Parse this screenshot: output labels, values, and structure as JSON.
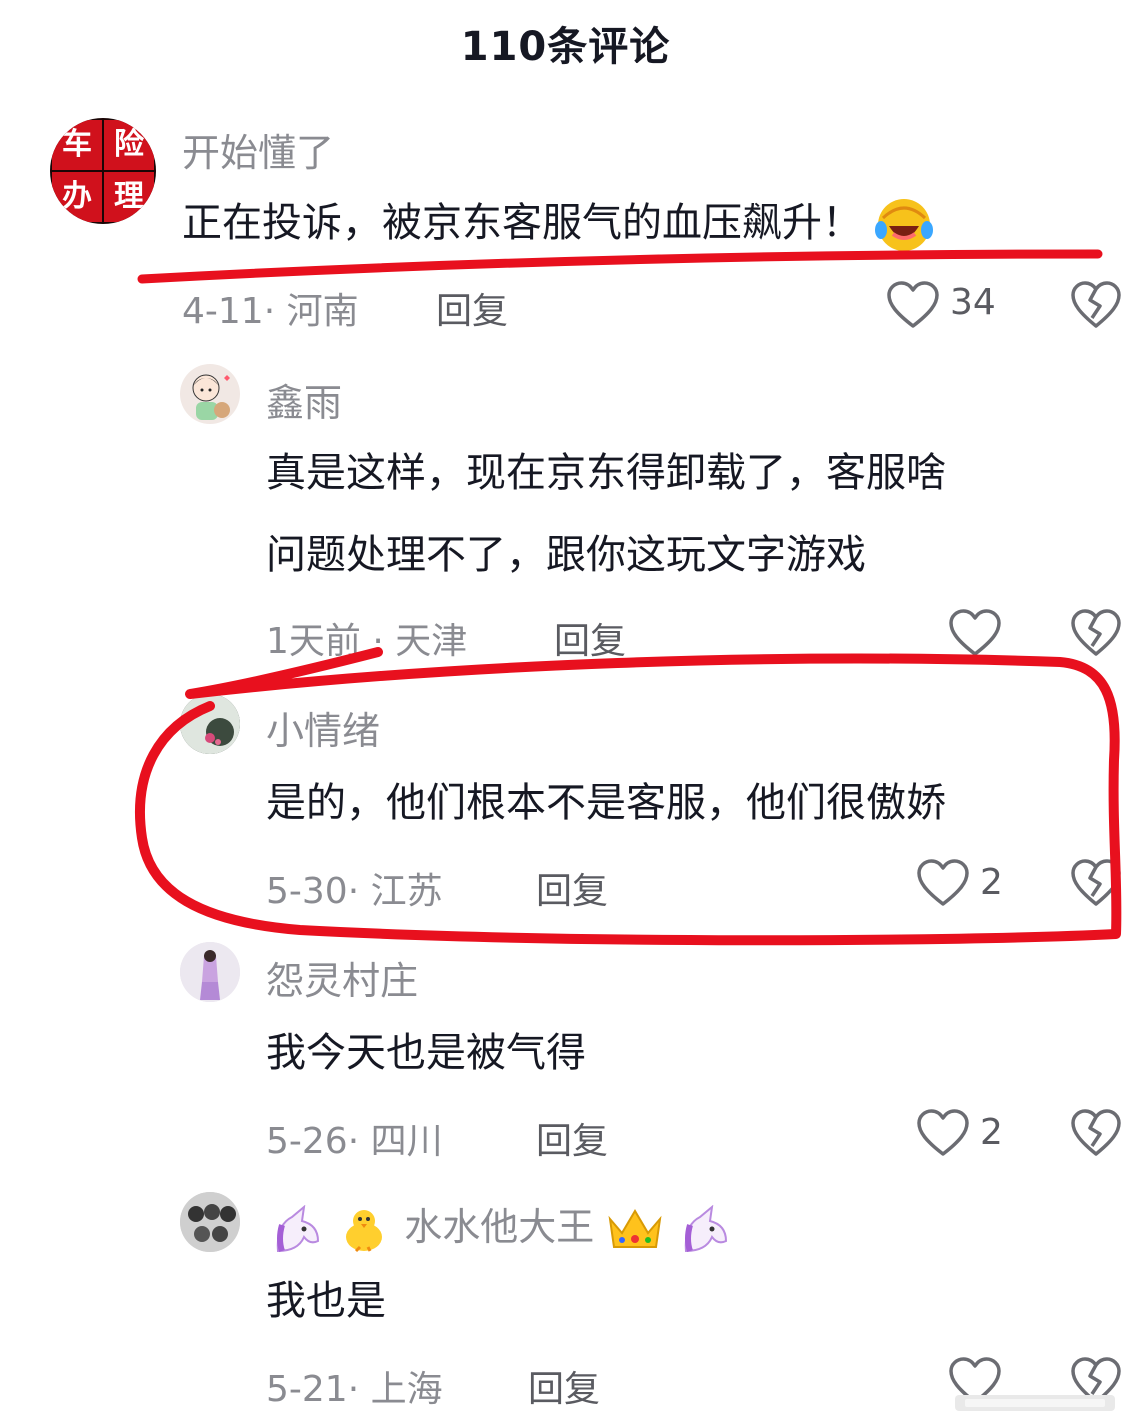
{
  "header": {
    "title": "110条评论"
  },
  "comments": [
    {
      "avatar_text": [
        "车",
        "险",
        "办",
        "理"
      ],
      "name": "开始懂了",
      "text": "正在投诉，被京东客服气的血压飙升！",
      "emoji": "laughing-tears-emoji",
      "date_location": "4-11· 河南",
      "reply_label": "回复",
      "likes": "34"
    },
    {
      "name": "鑫雨",
      "text_lines": [
        "真是这样，现在京东得卸载了，客服啥",
        "问题处理不了，跟你这玩文字游戏"
      ],
      "date_location": "1天前 · 天津",
      "reply_label": "回复",
      "likes": ""
    },
    {
      "name": "小情绪",
      "text": "是的，他们根本不是客服，他们很傲娇",
      "date_location": "5-30· 江苏",
      "reply_label": "回复",
      "likes": "2"
    },
    {
      "name": "怨灵村庄",
      "text": "我今天也是被气得",
      "date_location": "5-26· 四川",
      "reply_label": "回复",
      "likes": "2"
    },
    {
      "name": "水水他大王",
      "name_emojis": [
        "unicorn-emoji",
        "chick-emoji",
        "crown-emoji",
        "unicorn-emoji"
      ],
      "text": "我也是",
      "date_location": "5-21· 上海",
      "reply_label": "回复",
      "likes": ""
    }
  ],
  "colors": {
    "annotation_red": "#e8101e",
    "muted_text": "#8a8b91",
    "primary_text": "#161823",
    "avatar_red": "#d0111c"
  }
}
